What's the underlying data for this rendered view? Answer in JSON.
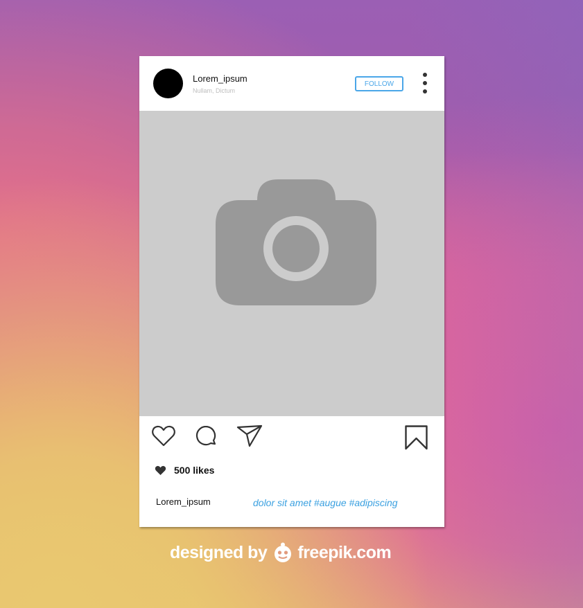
{
  "post": {
    "username": "Lorem_ipsum",
    "location": "Nullam, Dictum",
    "follow_label": "FOLLOW",
    "likes": "500 likes",
    "caption_user": "Lorem_ipsum",
    "caption_text": "dolor sit amet #augue #adipiscing"
  },
  "credit": {
    "prefix": "designed by",
    "brand": "freepik.com"
  },
  "icons": [
    "more-vertical-icon",
    "camera-icon",
    "heart-outline-icon",
    "comment-icon",
    "send-icon",
    "bookmark-icon",
    "heart-filled-icon",
    "freepik-logo-icon"
  ],
  "colors": {
    "accent": "#4aa6e8",
    "hashtag": "#3aa0e0",
    "photo_placeholder": "#cccccc",
    "camera": "#999999"
  }
}
